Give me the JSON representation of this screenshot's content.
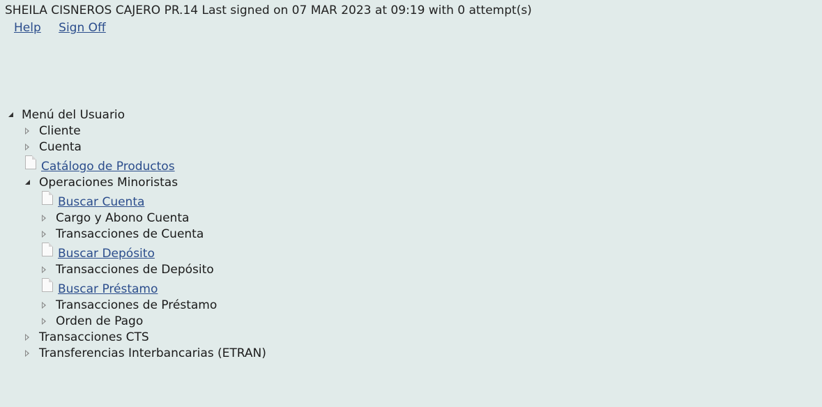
{
  "header": {
    "status_text": "SHEILA CISNEROS CAJERO PR.14 Last signed on 07 MAR 2023 at 09:19 with 0 attempt(s)",
    "help_label": "Help",
    "signoff_label": "Sign Off"
  },
  "tree": {
    "root": {
      "label": "Menú del Usuario",
      "icon": "expanded-triangle-icon"
    },
    "items": [
      {
        "label": "Cliente",
        "type": "folder",
        "state": "collapsed"
      },
      {
        "label": "Cuenta",
        "type": "folder",
        "state": "collapsed"
      },
      {
        "label": "Catálogo de Productos",
        "type": "link",
        "icon": "document-icon"
      },
      {
        "label": "Operaciones Minoristas",
        "type": "folder",
        "state": "expanded"
      },
      {
        "label": "Buscar Cuenta",
        "type": "link",
        "icon": "document-icon"
      },
      {
        "label": "Cargo y Abono Cuenta",
        "type": "folder",
        "state": "collapsed"
      },
      {
        "label": "Transacciones de Cuenta",
        "type": "folder",
        "state": "collapsed"
      },
      {
        "label": "Buscar Depósito",
        "type": "link",
        "icon": "document-icon"
      },
      {
        "label": "Transacciones de Depósito",
        "type": "folder",
        "state": "collapsed"
      },
      {
        "label": "Buscar Préstamo",
        "type": "link",
        "icon": "document-icon"
      },
      {
        "label": "Transacciones de Préstamo",
        "type": "folder",
        "state": "collapsed"
      },
      {
        "label": "Orden de Pago",
        "type": "folder",
        "state": "collapsed"
      },
      {
        "label": "Transacciones CTS",
        "type": "folder",
        "state": "collapsed"
      },
      {
        "label": "Transferencias Interbancarias (ETRAN)",
        "type": "folder",
        "state": "collapsed"
      }
    ]
  }
}
